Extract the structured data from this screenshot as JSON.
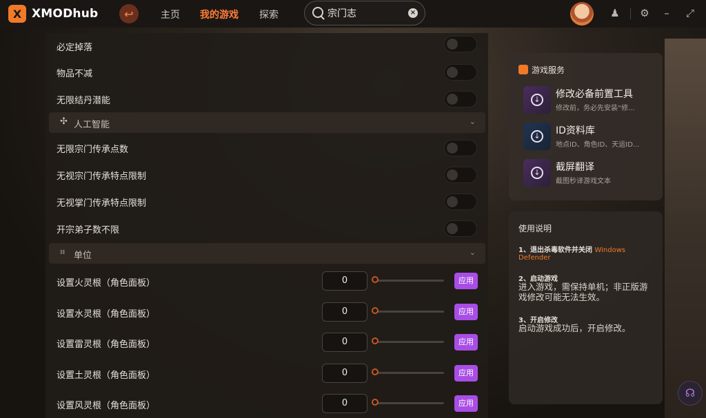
{
  "app": {
    "name": "XMODhub",
    "logo_letter": "X"
  },
  "nav": {
    "home": "主页",
    "my_games": "我的游戏",
    "explore": "探索"
  },
  "search": {
    "value": "宗门志",
    "clear": "×"
  },
  "toggles_top": [
    {
      "label": "必定掉落"
    },
    {
      "label": "物品不减"
    },
    {
      "label": "无限结丹潜能"
    }
  ],
  "section_ai": {
    "title": "人工智能",
    "chevron": "⌄"
  },
  "toggles_ai": [
    {
      "label": "无限宗门传承点数"
    },
    {
      "label": "无视宗门传承特点限制"
    },
    {
      "label": "无视掌门传承特点限制"
    },
    {
      "label": "开宗弟子数不限"
    }
  ],
  "section_unit": {
    "title": "单位",
    "chevron": "⌄"
  },
  "unit_rows": [
    {
      "label": "设置火灵根（角色面板）",
      "value": "0",
      "apply": "应用"
    },
    {
      "label": "设置水灵根（角色面板）",
      "value": "0",
      "apply": "应用"
    },
    {
      "label": "设置雷灵根（角色面板）",
      "value": "0",
      "apply": "应用"
    },
    {
      "label": "设置土灵根（角色面板）",
      "value": "0",
      "apply": "应用"
    },
    {
      "label": "设置风灵根（角色面板）",
      "value": "0",
      "apply": "应用"
    }
  ],
  "services": {
    "title": "游戏服务",
    "items": [
      {
        "title": "修改必备前置工具",
        "desc": "修改前，务必先安装“修..."
      },
      {
        "title": "ID资料库",
        "desc": "地点ID、角色ID、天运ID..."
      },
      {
        "title": "截屏翻译",
        "desc": "截图秒译游戏文本"
      }
    ]
  },
  "guide": {
    "title": "使用说明",
    "step1_title": "1、退出杀毒软件并关闭",
    "step1_highlight": "Windows",
    "step1_highlight2": "Defender",
    "step2_title": "2、启动游戏",
    "step2_text": "进入游戏，需保持单机；非正版游戏修改可能无法生效。",
    "step3_title": "3、开启修改",
    "step3_text": "启动游戏成功后，开启修改。"
  },
  "colors": {
    "accent": "#f07a2a",
    "apply": "#a84ee6"
  }
}
